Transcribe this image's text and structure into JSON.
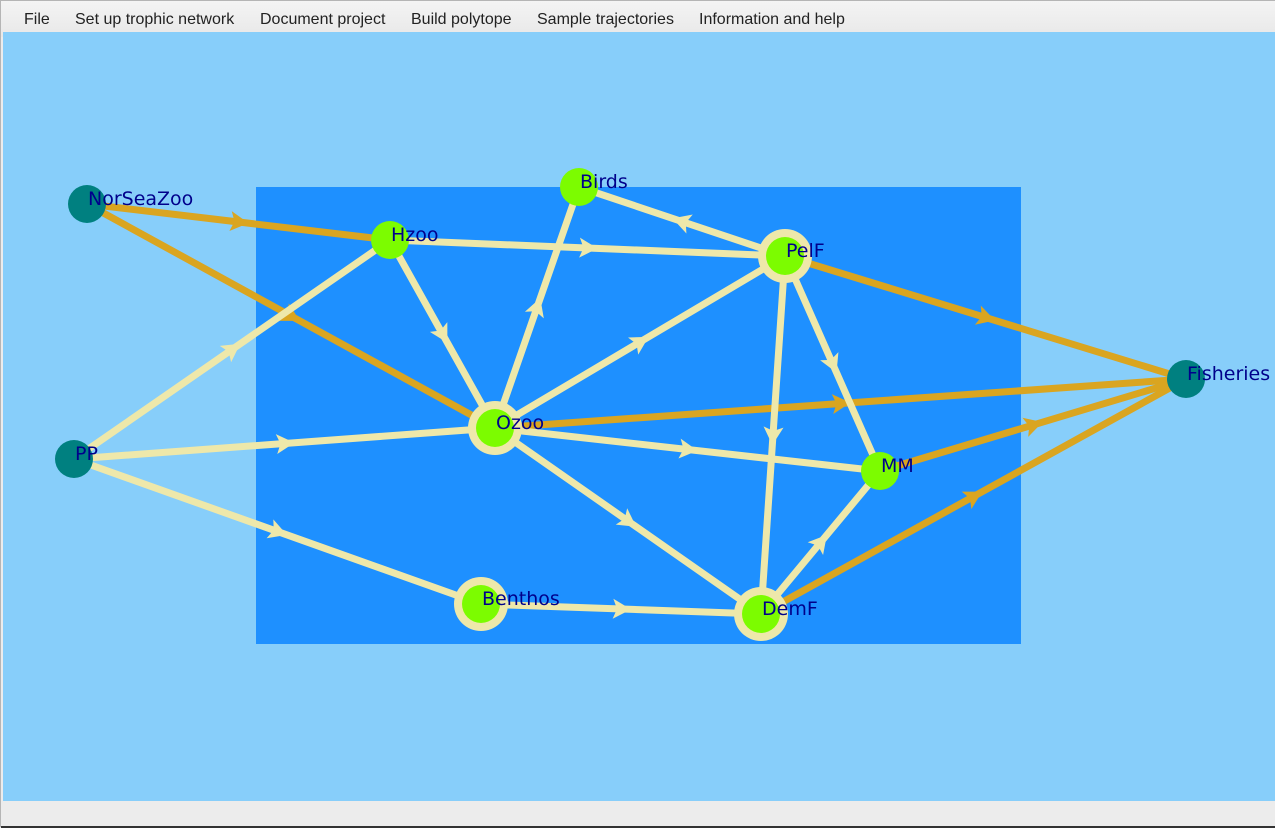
{
  "menu": [
    {
      "id": "file",
      "label": "File"
    },
    {
      "id": "setup",
      "label": "Set up trophic network"
    },
    {
      "id": "document",
      "label": "Document project"
    },
    {
      "id": "polytope",
      "label": "Build polytope"
    },
    {
      "id": "trajectories",
      "label": "Sample trajectories"
    },
    {
      "id": "help",
      "label": "Information and help"
    }
  ],
  "colors": {
    "canvas_bg": "#87cefa",
    "box_bg": "#1e90ff",
    "internal_node": "#7cfc00",
    "external_node": "#008080",
    "internal_flow": "#eee8aa",
    "external_flow": "#daa520",
    "node_halo": "#eee8aa",
    "label": "#00008b"
  },
  "network": {
    "nodes": [
      {
        "id": "NorSeaZoo",
        "label": "NorSeaZoo",
        "kind": "external",
        "halo": false
      },
      {
        "id": "PP",
        "label": "PP",
        "kind": "external",
        "halo": false
      },
      {
        "id": "Fisheries",
        "label": "Fisheries",
        "kind": "external",
        "halo": false
      },
      {
        "id": "Birds",
        "label": "Birds",
        "kind": "internal",
        "halo": false
      },
      {
        "id": "Hzoo",
        "label": "Hzoo",
        "kind": "internal",
        "halo": false
      },
      {
        "id": "PelF",
        "label": "PelF",
        "kind": "internal",
        "halo": true
      },
      {
        "id": "Ozoo",
        "label": "Ozoo",
        "kind": "internal",
        "halo": true
      },
      {
        "id": "MM",
        "label": "MM",
        "kind": "internal",
        "halo": false
      },
      {
        "id": "Benthos",
        "label": "Benthos",
        "kind": "internal",
        "halo": true
      },
      {
        "id": "DemF",
        "label": "DemF",
        "kind": "internal",
        "halo": true
      }
    ],
    "flows": [
      {
        "from": "NorSeaZoo",
        "to": "Hzoo",
        "kind": "external"
      },
      {
        "from": "NorSeaZoo",
        "to": "Ozoo",
        "kind": "external"
      },
      {
        "from": "PelF",
        "to": "Fisheries",
        "kind": "external"
      },
      {
        "from": "Ozoo",
        "to": "Fisheries",
        "kind": "external"
      },
      {
        "from": "MM",
        "to": "Fisheries",
        "kind": "external"
      },
      {
        "from": "DemF",
        "to": "Fisheries",
        "kind": "external"
      },
      {
        "from": "PP",
        "to": "Hzoo",
        "kind": "internal"
      },
      {
        "from": "PP",
        "to": "Ozoo",
        "kind": "internal"
      },
      {
        "from": "PP",
        "to": "Benthos",
        "kind": "internal"
      },
      {
        "from": "Hzoo",
        "to": "PelF",
        "kind": "internal"
      },
      {
        "from": "Hzoo",
        "to": "Ozoo",
        "kind": "internal"
      },
      {
        "from": "PelF",
        "to": "Birds",
        "kind": "internal"
      },
      {
        "from": "Ozoo",
        "to": "Birds",
        "kind": "internal"
      },
      {
        "from": "Ozoo",
        "to": "PelF",
        "kind": "internal"
      },
      {
        "from": "Ozoo",
        "to": "MM",
        "kind": "internal"
      },
      {
        "from": "Ozoo",
        "to": "DemF",
        "kind": "internal"
      },
      {
        "from": "PelF",
        "to": "MM",
        "kind": "internal"
      },
      {
        "from": "PelF",
        "to": "DemF",
        "kind": "internal"
      },
      {
        "from": "DemF",
        "to": "MM",
        "kind": "internal"
      },
      {
        "from": "Benthos",
        "to": "DemF",
        "kind": "internal"
      }
    ]
  }
}
